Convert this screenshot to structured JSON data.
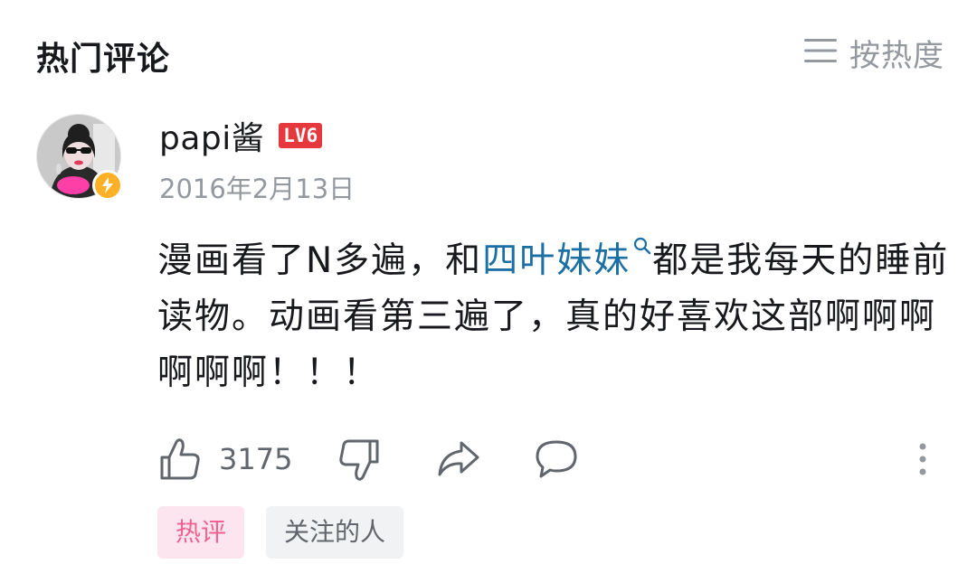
{
  "header": {
    "title": "热门评论",
    "sort_label": "按热度"
  },
  "comment": {
    "username": "papi酱",
    "level": "LV6",
    "timestamp": "2016年2月13日",
    "text_before": "漫画看了N多遍，和",
    "keyword": "四叶妹妹",
    "text_after": "都是我每天的睡前读物。动画看第三遍了，真的好喜欢这部啊啊啊啊啊啊！！！",
    "like_count": "3175"
  },
  "tags": {
    "hot": "热评",
    "following": "关注的人"
  },
  "colors": {
    "accent_pink": "#f0628f",
    "link_blue": "#1a6fa4",
    "level_red": "#e5393e",
    "vip_yellow": "#ffb027"
  },
  "icons": {
    "sort": "menu-lines-icon",
    "like": "thumbs-up-icon",
    "dislike": "thumbs-down-icon",
    "share": "share-arrow-icon",
    "reply": "speech-bubble-icon",
    "more": "vertical-dots-icon",
    "search": "search-icon",
    "vip": "lightning-icon"
  }
}
